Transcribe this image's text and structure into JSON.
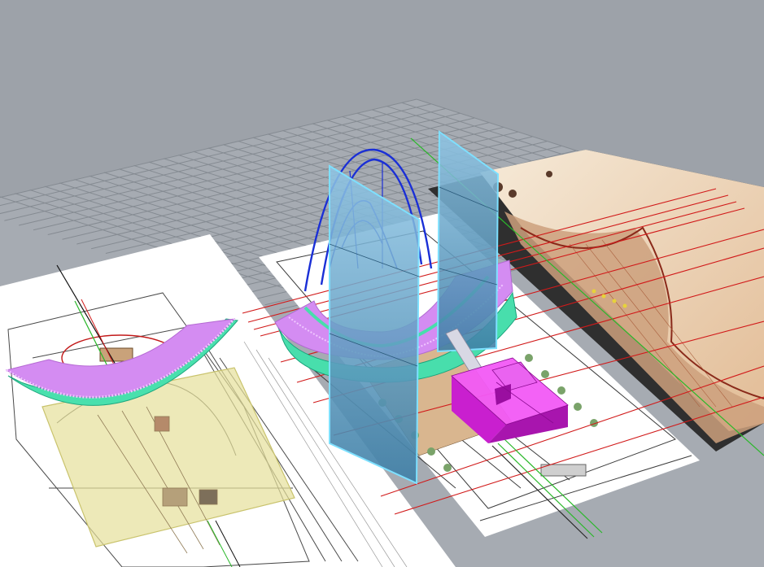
{
  "viewport": {
    "name": "perspective-3d-viewport",
    "background": "#9da2a9"
  },
  "colors": {
    "grid_line": "#7f858c",
    "grid_bg": "#a3a8af",
    "sheet": "#ffffff",
    "plan_line": "#3a3a3a",
    "magenta_mass": "#e12ee8",
    "violet_roof": "#d48cf2",
    "mint_edge": "#4fe3b0",
    "glass_panel": "#6fa7c8",
    "glass_edge": "#7ee0ff",
    "arch_blue": "#1a2fd6",
    "section_dark": "#2e2e2e",
    "section_tan": "#e3c4a4",
    "red_guide": "#d11a1a",
    "green_axis": "#2bb82b",
    "yellow_plane": "#e7e29a"
  },
  "icons": [
    "construction-grid",
    "floor-plan-sheet",
    "section-drawing",
    "glass-fin",
    "parabolic-arch",
    "magenta-block"
  ]
}
